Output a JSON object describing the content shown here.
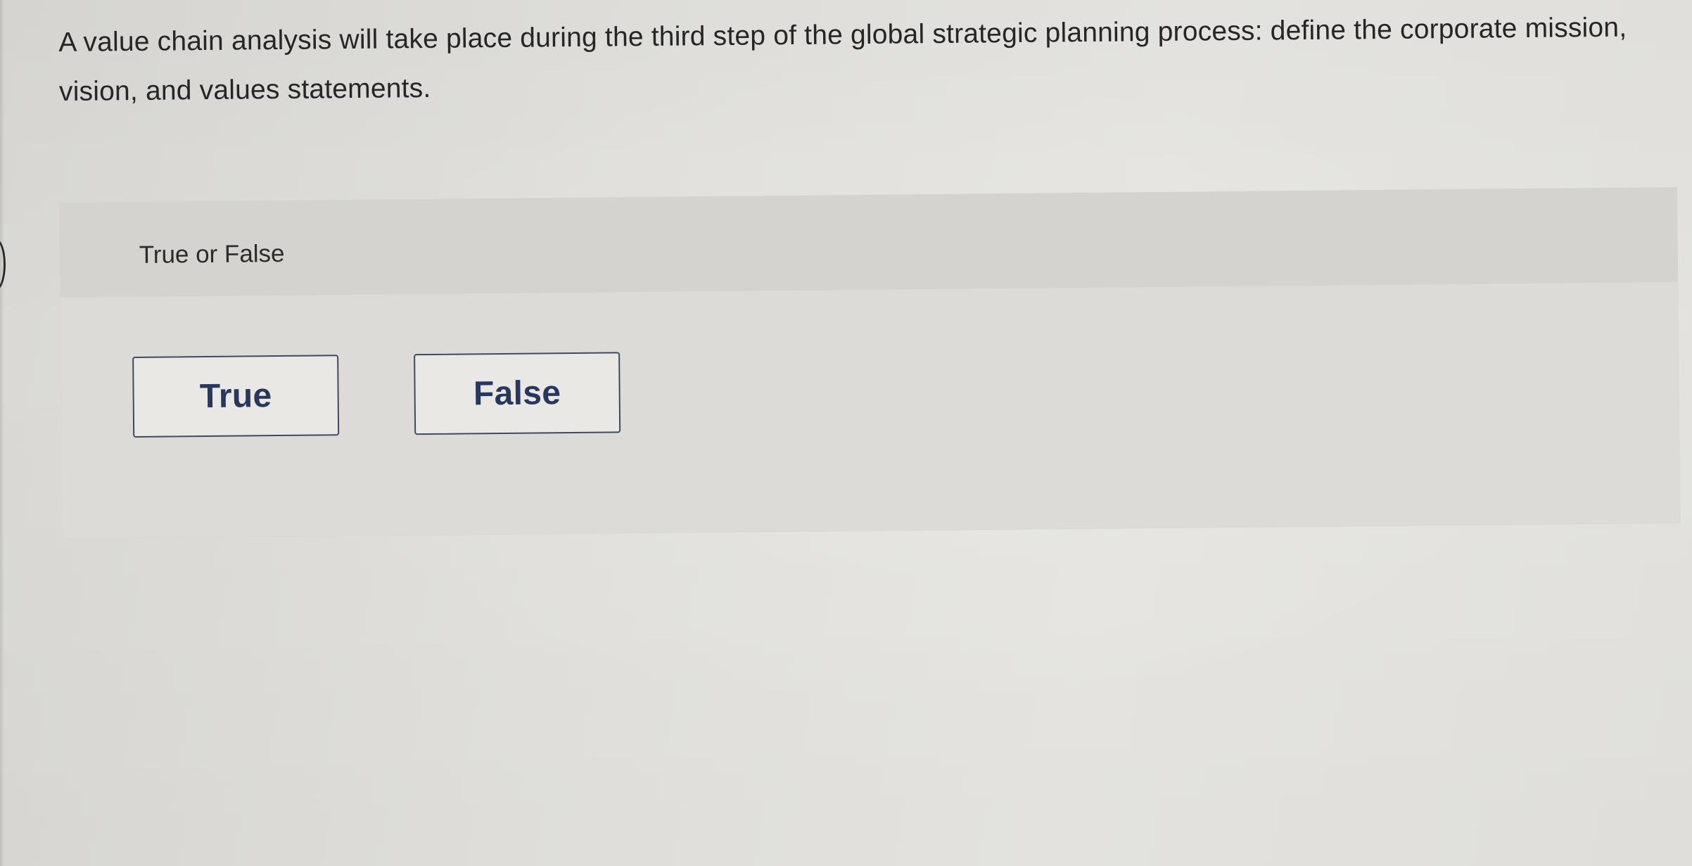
{
  "question": {
    "text": "A value chain analysis will take place during the third step of the global strategic planning process: define the corporate mission, vision, and values statements."
  },
  "answer_panel": {
    "prompt": "True or False",
    "options": [
      {
        "label": "True"
      },
      {
        "label": "False"
      }
    ]
  },
  "colors": {
    "background": "#e2e1dd",
    "panel": "#dcdbd7",
    "panel_header": "#d4d3cf",
    "button_border": "#3f4a62",
    "button_text": "#27375e",
    "question_text": "#262626"
  }
}
